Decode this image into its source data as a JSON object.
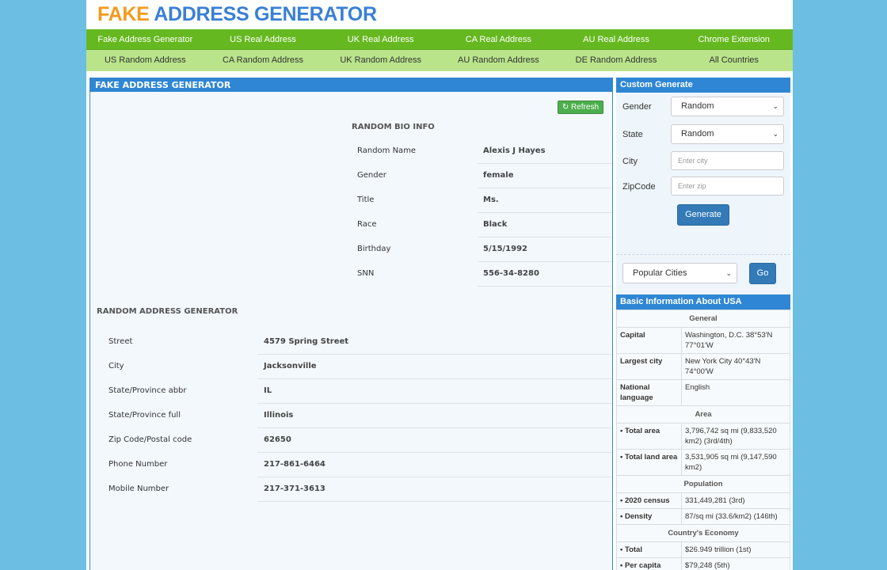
{
  "logo": {
    "part1": "FAKE",
    "part2": "ADDRESS GENERATOR"
  },
  "nav_primary": [
    "Fake Address Generator",
    "US Real Address",
    "UK Real Address",
    "CA Real Address",
    "AU Real Address",
    "Chrome Extension"
  ],
  "nav_secondary": [
    "US Random Address",
    "CA Random Address",
    "UK Random Address",
    "AU Random Address",
    "DE Random Address",
    "All Countries"
  ],
  "main": {
    "title": "FAKE ADDRESS GENERATOR",
    "refresh_label": "Refresh",
    "bio_title": "RANDOM BIO INFO",
    "bio": [
      {
        "label": "Random Name",
        "value": "Alexis J Hayes"
      },
      {
        "label": "Gender",
        "value": "female"
      },
      {
        "label": "Title",
        "value": "Ms."
      },
      {
        "label": "Race",
        "value": "Black"
      },
      {
        "label": "Birthday",
        "value": "5/15/1992"
      },
      {
        "label": "SNN",
        "value": "556-34-8280"
      }
    ],
    "address_title": "RANDOM ADDRESS GENERATOR",
    "address": [
      {
        "label": "Street",
        "value": "4579 Spring Street"
      },
      {
        "label": "City",
        "value": "Jacksonville"
      },
      {
        "label": "State/Province abbr",
        "value": "IL"
      },
      {
        "label": "State/Province full",
        "value": "Illinois"
      },
      {
        "label": "Zip Code/Postal code",
        "value": "62650"
      },
      {
        "label": "Phone Number",
        "value": "217-861-6464"
      },
      {
        "label": "Mobile Number",
        "value": "217-371-3613"
      }
    ]
  },
  "custom": {
    "title": "Custom Generate",
    "gender_label": "Gender",
    "gender_value": "Random",
    "state_label": "State",
    "state_value": "Random",
    "city_label": "City",
    "city_placeholder": "Enter city",
    "zip_label": "ZipCode",
    "zip_placeholder": "Enter zip",
    "generate_label": "Generate",
    "cities_value": "Popular Cities",
    "go_label": "Go"
  },
  "facts": {
    "title": "Basic Information About USA",
    "general": "General",
    "capital_k": "Capital",
    "capital_v": "Washington, D.C. 38°53′N 77°01′W",
    "largest_k": "Largest city",
    "largest_v": "New York City 40°43′N 74°00′W",
    "lang_k": "National language",
    "lang_v": "English",
    "area": "Area",
    "total_area_k": "• Total area",
    "total_area_v": "3,796,742 sq mi (9,833,520 km2) (3rd/4th)",
    "land_area_k": "• Total land area",
    "land_area_v": "3,531,905 sq mi (9,147,590 km2)",
    "population": "Population",
    "census_k": "• 2020 census",
    "census_v": "331,449,281 (3rd)",
    "density_k": "• Density",
    "density_v": "87/sq mi (33.6/km2) (146th)",
    "economy": "Country's Economy",
    "total_k": "• Total",
    "total_v": "$26.949 trillion (1st)",
    "percap_k": "• Per capita",
    "percap_v": "$79,248 (5th)"
  },
  "colors": {
    "background": "#6cbfe2",
    "nav_primary": "#66b820",
    "nav_secondary": "#b9e48a",
    "header_blue": "#2e86d4",
    "logo_orange": "#f39a1e",
    "logo_blue": "#3a7fd5"
  }
}
